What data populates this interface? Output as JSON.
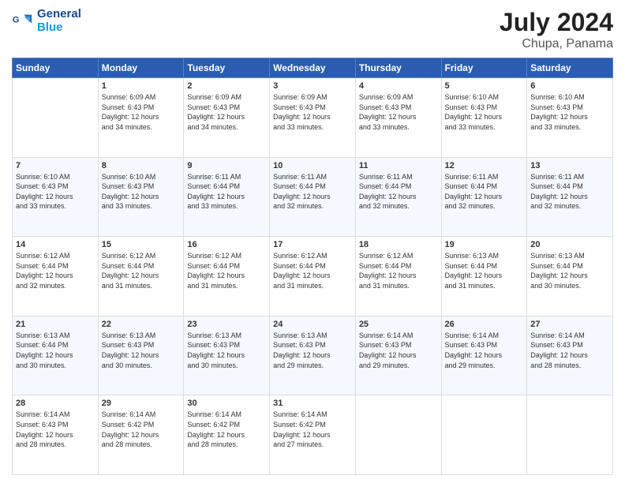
{
  "header": {
    "logo_line1": "General",
    "logo_line2": "Blue",
    "month": "July 2024",
    "location": "Chupa, Panama"
  },
  "days_of_week": [
    "Sunday",
    "Monday",
    "Tuesday",
    "Wednesday",
    "Thursday",
    "Friday",
    "Saturday"
  ],
  "weeks": [
    [
      {
        "day": "",
        "info": ""
      },
      {
        "day": "1",
        "info": "Sunrise: 6:09 AM\nSunset: 6:43 PM\nDaylight: 12 hours\nand 34 minutes."
      },
      {
        "day": "2",
        "info": "Sunrise: 6:09 AM\nSunset: 6:43 PM\nDaylight: 12 hours\nand 34 minutes."
      },
      {
        "day": "3",
        "info": "Sunrise: 6:09 AM\nSunset: 6:43 PM\nDaylight: 12 hours\nand 33 minutes."
      },
      {
        "day": "4",
        "info": "Sunrise: 6:09 AM\nSunset: 6:43 PM\nDaylight: 12 hours\nand 33 minutes."
      },
      {
        "day": "5",
        "info": "Sunrise: 6:10 AM\nSunset: 6:43 PM\nDaylight: 12 hours\nand 33 minutes."
      },
      {
        "day": "6",
        "info": "Sunrise: 6:10 AM\nSunset: 6:43 PM\nDaylight: 12 hours\nand 33 minutes."
      }
    ],
    [
      {
        "day": "7",
        "info": "Sunrise: 6:10 AM\nSunset: 6:43 PM\nDaylight: 12 hours\nand 33 minutes."
      },
      {
        "day": "8",
        "info": "Sunrise: 6:10 AM\nSunset: 6:43 PM\nDaylight: 12 hours\nand 33 minutes."
      },
      {
        "day": "9",
        "info": "Sunrise: 6:11 AM\nSunset: 6:44 PM\nDaylight: 12 hours\nand 33 minutes."
      },
      {
        "day": "10",
        "info": "Sunrise: 6:11 AM\nSunset: 6:44 PM\nDaylight: 12 hours\nand 32 minutes."
      },
      {
        "day": "11",
        "info": "Sunrise: 6:11 AM\nSunset: 6:44 PM\nDaylight: 12 hours\nand 32 minutes."
      },
      {
        "day": "12",
        "info": "Sunrise: 6:11 AM\nSunset: 6:44 PM\nDaylight: 12 hours\nand 32 minutes."
      },
      {
        "day": "13",
        "info": "Sunrise: 6:11 AM\nSunset: 6:44 PM\nDaylight: 12 hours\nand 32 minutes."
      }
    ],
    [
      {
        "day": "14",
        "info": "Sunrise: 6:12 AM\nSunset: 6:44 PM\nDaylight: 12 hours\nand 32 minutes."
      },
      {
        "day": "15",
        "info": "Sunrise: 6:12 AM\nSunset: 6:44 PM\nDaylight: 12 hours\nand 31 minutes."
      },
      {
        "day": "16",
        "info": "Sunrise: 6:12 AM\nSunset: 6:44 PM\nDaylight: 12 hours\nand 31 minutes."
      },
      {
        "day": "17",
        "info": "Sunrise: 6:12 AM\nSunset: 6:44 PM\nDaylight: 12 hours\nand 31 minutes."
      },
      {
        "day": "18",
        "info": "Sunrise: 6:12 AM\nSunset: 6:44 PM\nDaylight: 12 hours\nand 31 minutes."
      },
      {
        "day": "19",
        "info": "Sunrise: 6:13 AM\nSunset: 6:44 PM\nDaylight: 12 hours\nand 31 minutes."
      },
      {
        "day": "20",
        "info": "Sunrise: 6:13 AM\nSunset: 6:44 PM\nDaylight: 12 hours\nand 30 minutes."
      }
    ],
    [
      {
        "day": "21",
        "info": "Sunrise: 6:13 AM\nSunset: 6:44 PM\nDaylight: 12 hours\nand 30 minutes."
      },
      {
        "day": "22",
        "info": "Sunrise: 6:13 AM\nSunset: 6:43 PM\nDaylight: 12 hours\nand 30 minutes."
      },
      {
        "day": "23",
        "info": "Sunrise: 6:13 AM\nSunset: 6:43 PM\nDaylight: 12 hours\nand 30 minutes."
      },
      {
        "day": "24",
        "info": "Sunrise: 6:13 AM\nSunset: 6:43 PM\nDaylight: 12 hours\nand 29 minutes."
      },
      {
        "day": "25",
        "info": "Sunrise: 6:14 AM\nSunset: 6:43 PM\nDaylight: 12 hours\nand 29 minutes."
      },
      {
        "day": "26",
        "info": "Sunrise: 6:14 AM\nSunset: 6:43 PM\nDaylight: 12 hours\nand 29 minutes."
      },
      {
        "day": "27",
        "info": "Sunrise: 6:14 AM\nSunset: 6:43 PM\nDaylight: 12 hours\nand 28 minutes."
      }
    ],
    [
      {
        "day": "28",
        "info": "Sunrise: 6:14 AM\nSunset: 6:43 PM\nDaylight: 12 hours\nand 28 minutes."
      },
      {
        "day": "29",
        "info": "Sunrise: 6:14 AM\nSunset: 6:42 PM\nDaylight: 12 hours\nand 28 minutes."
      },
      {
        "day": "30",
        "info": "Sunrise: 6:14 AM\nSunset: 6:42 PM\nDaylight: 12 hours\nand 28 minutes."
      },
      {
        "day": "31",
        "info": "Sunrise: 6:14 AM\nSunset: 6:42 PM\nDaylight: 12 hours\nand 27 minutes."
      },
      {
        "day": "",
        "info": ""
      },
      {
        "day": "",
        "info": ""
      },
      {
        "day": "",
        "info": ""
      }
    ]
  ]
}
